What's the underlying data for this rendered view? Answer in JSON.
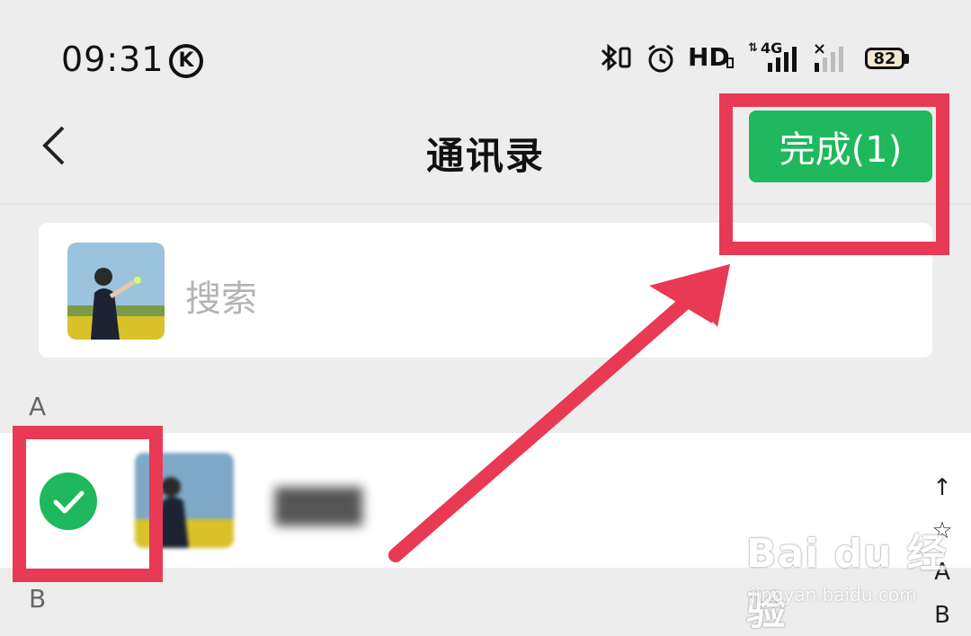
{
  "status_bar": {
    "time": "09:31",
    "k_icon": "K",
    "network_type": "4G",
    "hd_label": "HD",
    "battery": "82"
  },
  "header": {
    "title": "通讯录",
    "done_button": "完成(1)"
  },
  "search": {
    "placeholder": "搜索"
  },
  "sections": [
    {
      "letter": "A"
    },
    {
      "letter": "B"
    }
  ],
  "index_bar": [
    "↑",
    "☆",
    "A",
    "B"
  ],
  "watermark": {
    "brand": "Bai du 经验",
    "url": "jingyan.baidu.com"
  },
  "colors": {
    "accent_green": "#1fb85c",
    "annotation_red": "#e83a55",
    "background": "#ededed"
  }
}
